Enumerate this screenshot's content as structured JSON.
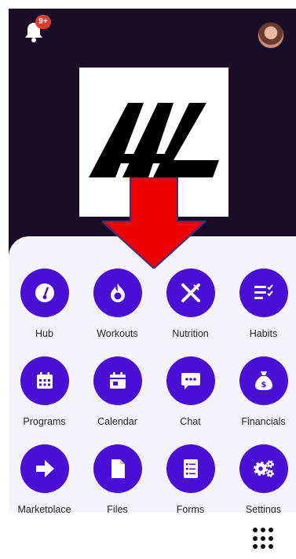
{
  "header": {
    "notification_badge": "9+",
    "logo_text": "AAL"
  },
  "colors": {
    "hero_background": "#1a0d26",
    "tile_purple": "#4a0fd6",
    "badge_red": "#e53935",
    "arrow_red": "#ee0000"
  },
  "menu": [
    {
      "label": "Hub",
      "icon": "speedometer-icon"
    },
    {
      "label": "Workouts",
      "icon": "flame-icon"
    },
    {
      "label": "Nutrition",
      "icon": "fork-knife-icon"
    },
    {
      "label": "Habits",
      "icon": "checklist-icon"
    },
    {
      "label": "Programs",
      "icon": "calendar-grid-icon"
    },
    {
      "label": "Calendar",
      "icon": "calendar-icon"
    },
    {
      "label": "Chat",
      "icon": "chat-bubble-icon"
    },
    {
      "label": "Financials",
      "icon": "money-bag-icon"
    },
    {
      "label": "Marketplace",
      "icon": "navigation-arrow-icon"
    },
    {
      "label": "Files",
      "icon": "file-icon"
    },
    {
      "label": "Forms",
      "icon": "form-icon"
    },
    {
      "label": "Settings",
      "icon": "gears-icon"
    }
  ]
}
